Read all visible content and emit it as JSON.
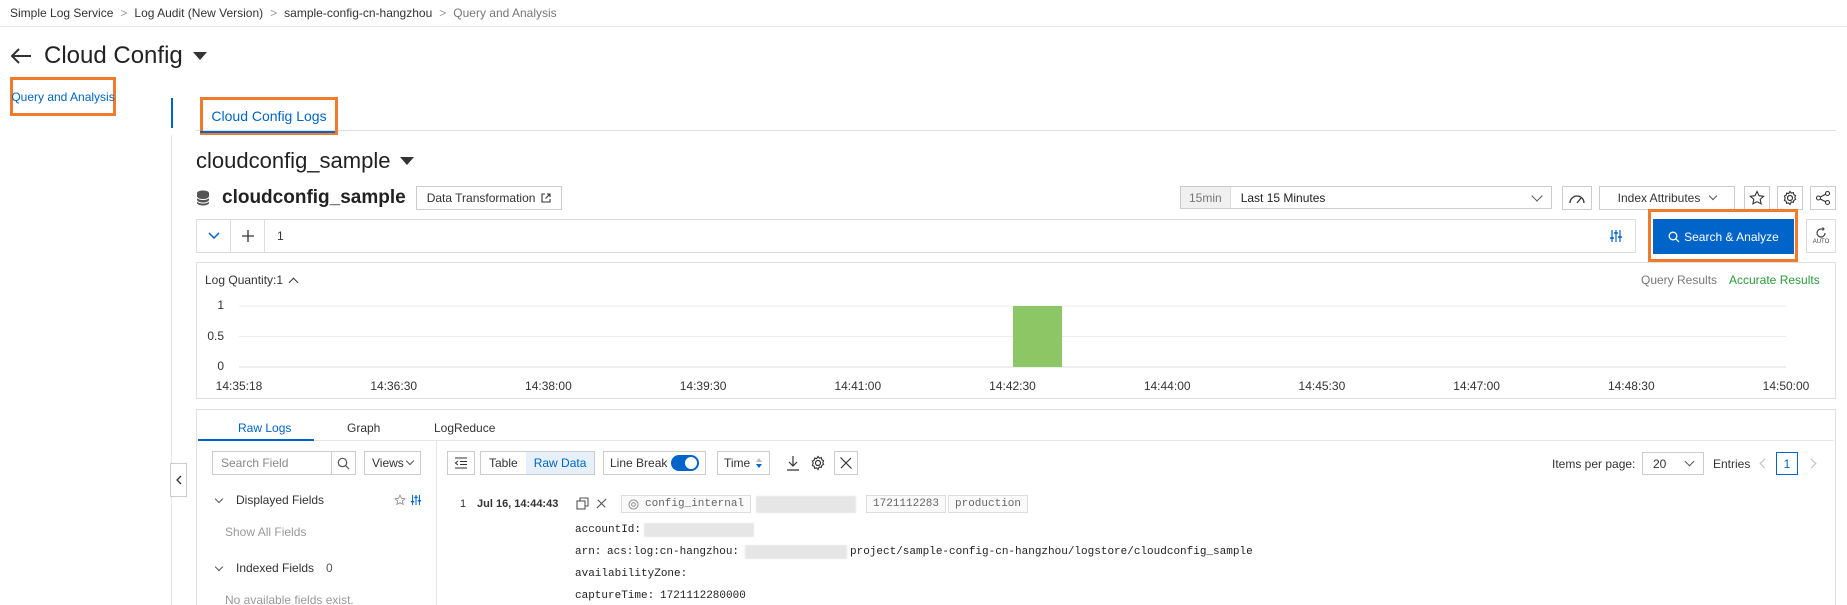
{
  "breadcrumb": [
    "Simple Log Service",
    "Log Audit (New Version)",
    "sample-config-cn-hangzhou",
    "Query and Analysis"
  ],
  "page": {
    "title": "Cloud Config"
  },
  "left_nav": {
    "item": "Query and Analysis"
  },
  "tab": {
    "label": "Cloud Config Logs"
  },
  "logstore": {
    "dropdown_title": "cloudconfig_sample",
    "name": "cloudconfig_sample",
    "data_transformation": "Data Transformation"
  },
  "time": {
    "chip": "15min",
    "label": "Last 15 Minutes"
  },
  "index_attributes": "Index Attributes",
  "query": {
    "line_number": "1"
  },
  "search_button": "Search & Analyze",
  "auto_label": "AUTO",
  "chart": {
    "log_quantity": "Log Quantity:1",
    "query_results": "Query Results",
    "accurate_results": "Accurate Results"
  },
  "chart_data": {
    "type": "bar",
    "yticks": [
      "1",
      "0.5",
      "0"
    ],
    "ylim": [
      0,
      1
    ],
    "xticks": [
      "14:35:18",
      "14:36:30",
      "14:38:00",
      "14:39:30",
      "14:41:00",
      "14:42:30",
      "14:44:00",
      "14:45:30",
      "14:47:00",
      "14:48:30",
      "14:50:00"
    ],
    "bars": [
      {
        "x_fraction": 0.5,
        "value": 1
      }
    ],
    "bar_color": "#8cc665"
  },
  "subtabs": [
    "Raw Logs",
    "Graph",
    "LogReduce"
  ],
  "sidebar": {
    "search_placeholder": "Search Field",
    "views": "Views",
    "displayed_fields": "Displayed Fields",
    "show_all": "Show All Fields",
    "indexed_fields": "Indexed Fields",
    "indexed_count": "0",
    "no_fields": "No available fields exist."
  },
  "toolbar": {
    "table": "Table",
    "raw_data": "Raw Data",
    "line_break": "Line Break",
    "time": "Time",
    "items_per_page": "Items per page:",
    "page_size": "20",
    "entries": "Entries",
    "page": "1"
  },
  "log": {
    "index": "1",
    "time": "Jul 16, 14:44:43",
    "tags": [
      "config_internal",
      "1721112283",
      "production"
    ],
    "fields": [
      {
        "key": "accountId:",
        "value": ""
      },
      {
        "key": "arn:",
        "value": "acs:log:cn-hangzhou:",
        "suffix": "project/sample-config-cn-hangzhou/logstore/cloudconfig_sample"
      },
      {
        "key": "availabilityZone:",
        "value": ""
      },
      {
        "key": "captureTime:",
        "value": "1721112280000"
      }
    ]
  },
  "colors": {
    "accent": "#0064c8",
    "highlight": "#f07b2a",
    "success": "#2b9a3a"
  }
}
